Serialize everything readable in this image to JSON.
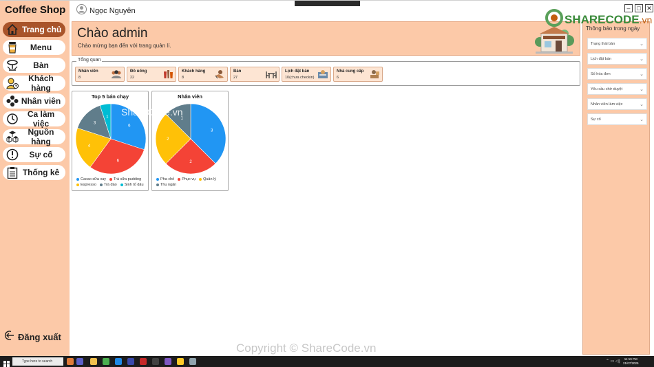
{
  "app": {
    "title": "Coffee Shop"
  },
  "user": {
    "name": "Ngọc Nguyên"
  },
  "nav": {
    "items": [
      {
        "label": "Trang chủ",
        "icon": "home-icon",
        "active": true
      },
      {
        "label": "Menu",
        "icon": "cup-icon",
        "active": false
      },
      {
        "label": "Bàn",
        "icon": "table-icon",
        "active": false
      },
      {
        "label": "Khách hàng",
        "icon": "customer-icon",
        "active": false
      },
      {
        "label": "Nhân viên",
        "icon": "staff-icon",
        "active": false
      },
      {
        "label": "Ca làm việc",
        "icon": "clock-icon",
        "active": false
      },
      {
        "label": "Nguồn hàng",
        "icon": "boxes-icon",
        "active": false
      },
      {
        "label": "Sự cố",
        "icon": "alert-icon",
        "active": false
      },
      {
        "label": "Thống kê",
        "icon": "clipboard-icon",
        "active": false
      }
    ],
    "logout": "Đăng xuất"
  },
  "banner": {
    "title": "Chào admin",
    "subtitle": "Chào mừng bạn đến với trang quản lí."
  },
  "overview": {
    "legend": "Tổng quan",
    "cards": [
      {
        "title": "Nhân viên",
        "value": "8",
        "icon": "staff-group-icon"
      },
      {
        "title": "Đồ uống",
        "value": "22",
        "icon": "drinks-icon"
      },
      {
        "title": "Khách hàng",
        "value": "8",
        "icon": "customer-icon"
      },
      {
        "title": "Bàn",
        "value": "27",
        "icon": "tables-icon"
      },
      {
        "title": "Lịch đặt bàn",
        "value": "10(chưa checkin)",
        "icon": "booking-icon"
      },
      {
        "title": "Nhà cung cấp",
        "value": "6",
        "icon": "supplier-icon"
      }
    ]
  },
  "notifications": {
    "title": "Thông báo trong ngày",
    "items": [
      "Trạng thái bàn",
      "Lịch đặt bàn",
      "Số hóa đơn",
      "Yêu cầu chờ duyệt",
      "Nhân viên làm việc",
      "Sự cố"
    ]
  },
  "colors": {
    "sidebar": "#fcc9a8",
    "accent": "#a9542a",
    "card": "#fde5d3"
  },
  "chart_data": [
    {
      "type": "pie",
      "title": "Top 5 bán chạy",
      "categories": [
        "Cacao sữa xay",
        "Trà sữa pudding",
        "Espresso",
        "Trà đào",
        "Sinh tố dâu"
      ],
      "values": [
        6,
        6,
        4,
        3,
        1
      ],
      "colors": [
        "#2196f3",
        "#f44336",
        "#ffc107",
        "#607d8b",
        "#00bcd4"
      ]
    },
    {
      "type": "pie",
      "title": "Nhân viên",
      "categories": [
        "Pha chế",
        "Phục vụ",
        "Quản lý",
        "Thu ngân"
      ],
      "values": [
        3,
        2,
        2,
        1
      ],
      "colors": [
        "#2196f3",
        "#f44336",
        "#ffc107",
        "#607d8b"
      ]
    }
  ],
  "watermark": {
    "logo": "SHARECODE",
    "logo_ext": ".vn",
    "center": "ShareCode.vn",
    "bottom": "Copyright © ShareCode.vn"
  },
  "taskbar": {
    "search": "Type here to search",
    "time": "11:19 PM",
    "date": "21/07/2025"
  }
}
